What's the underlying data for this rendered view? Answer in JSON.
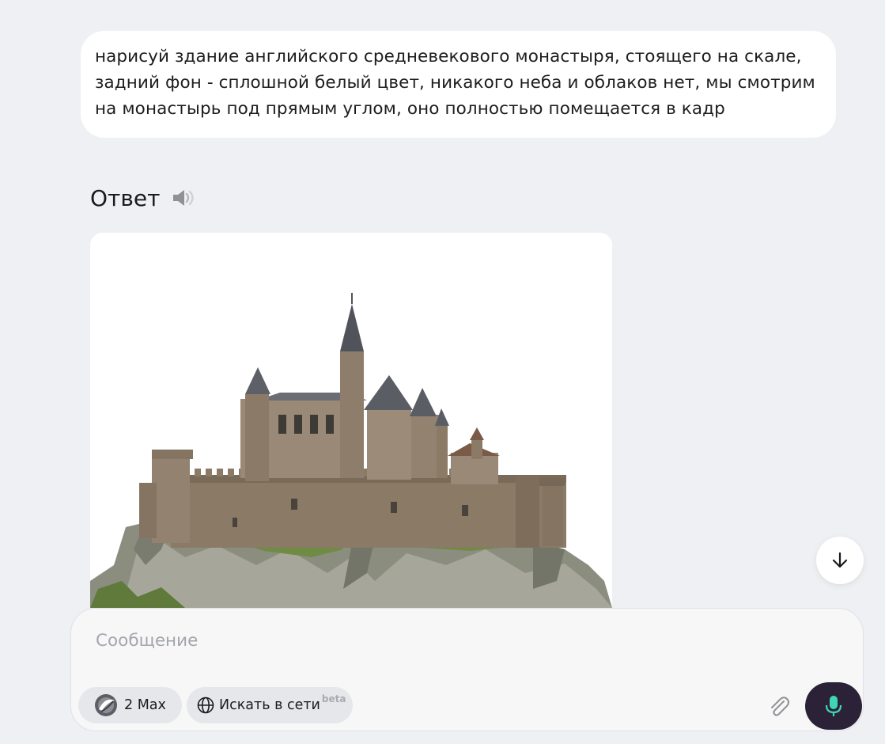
{
  "user_message": {
    "text": "нарисуй здание английского средневекового монастыря, стоящего на скале, задний фон - сплошной белый цвет, никакого неба и облаков нет, мы смотрим на монастырь под прямым углом, оно полностью помещается в кадр"
  },
  "answer": {
    "title": "Ответ",
    "speaker_icon": "speaker-icon",
    "image_icon": "castle-on-rock-image"
  },
  "scroll_down": {
    "icon": "arrow-down-icon"
  },
  "composer": {
    "placeholder": "Сообщение",
    "model_chip": {
      "icon": "model-logo-icon",
      "label": "2 Max"
    },
    "search_chip": {
      "icon": "globe-icon",
      "label": "Искать в сети",
      "badge": "beta"
    },
    "attach_icon": "paperclip-icon",
    "mic_icon": "microphone-icon"
  },
  "colors": {
    "background": "#eef0f3",
    "bubble": "#ffffff",
    "mic_button": "#2b2238",
    "mic_accent": "#3fd6b4",
    "chip": "#e6e7ea"
  }
}
